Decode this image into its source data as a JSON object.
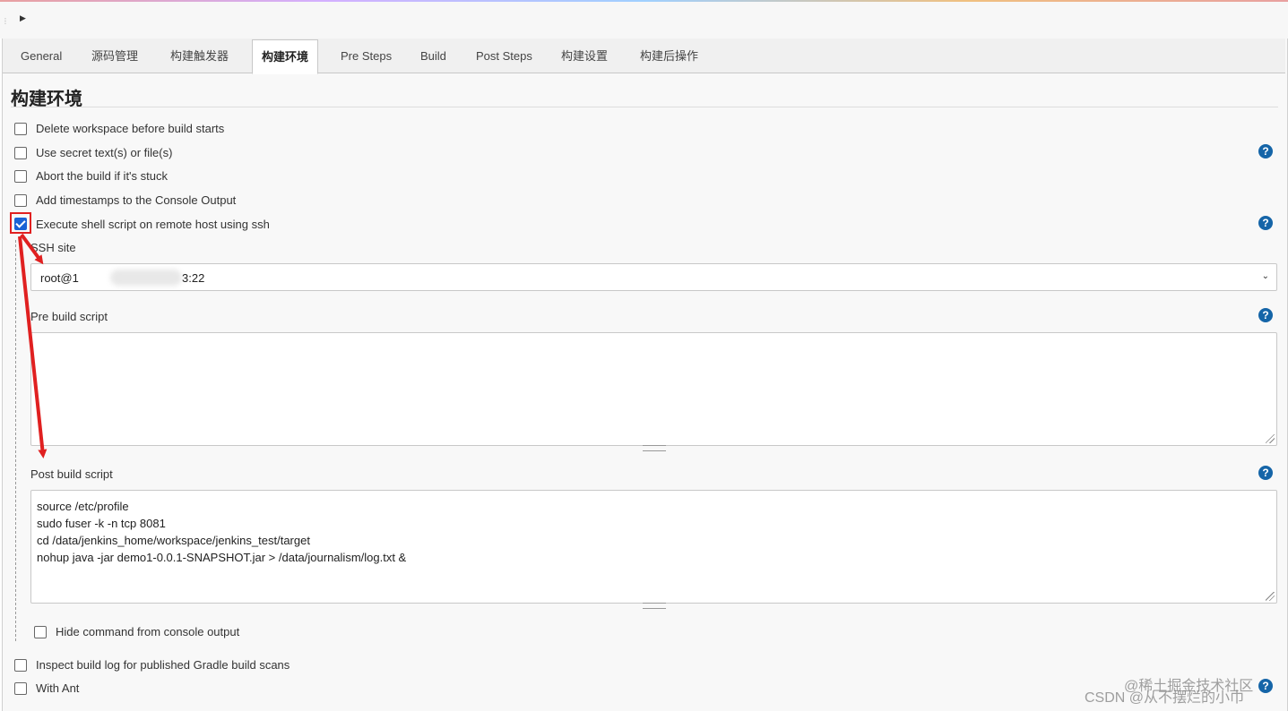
{
  "tabs": [
    {
      "label": "General",
      "active": false
    },
    {
      "label": "源码管理",
      "active": false
    },
    {
      "label": "构建触发器",
      "active": false
    },
    {
      "label": "构建环境",
      "active": true
    },
    {
      "label": "Pre Steps",
      "active": false
    },
    {
      "label": "Build",
      "active": false
    },
    {
      "label": "Post Steps",
      "active": false
    },
    {
      "label": "构建设置",
      "active": false
    },
    {
      "label": "构建后操作",
      "active": false
    }
  ],
  "section": {
    "title": "构建环境"
  },
  "options": [
    {
      "label": "Delete workspace before build starts",
      "checked": false
    },
    {
      "label": "Use secret text(s) or file(s)",
      "checked": false,
      "help": true
    },
    {
      "label": "Abort the build if it's stuck",
      "checked": false
    },
    {
      "label": "Add timestamps to the Console Output",
      "checked": false
    },
    {
      "label": "Execute shell script on remote host using ssh",
      "checked": true,
      "help": true
    }
  ],
  "ssh": {
    "site_label": "SSH site",
    "site_value_prefix": "root@1",
    "site_value_suffix": "3:22",
    "pre_label": "Pre build script",
    "pre_value": "",
    "post_label": "Post build script",
    "post_lines": [
      "source /etc/profile",
      "sudo fuser -k -n tcp 8081",
      "cd /data/jenkins_home/workspace/jenkins_test/target",
      "nohup java -jar demo1-0.0.1-SNAPSHOT.jar > /data/journalism/log.txt &"
    ],
    "hide_label": "Hide command from console output",
    "hide_checked": false
  },
  "bottom_options": [
    {
      "label": "Inspect build log for published Gradle build scans",
      "checked": false
    },
    {
      "label": "With Ant",
      "checked": false
    }
  ],
  "help_glyph": "?",
  "icons": {
    "top_caret": "▶",
    "select_chevron": "⌄"
  },
  "watermarks": {
    "line1": "@稀土掘金技术社区",
    "line2": "CSDN @从不摆烂的小巾"
  },
  "colors": {
    "accent": "#1565a8",
    "checkbox_checked": "#1a63d5",
    "annotation": "#e02020"
  }
}
